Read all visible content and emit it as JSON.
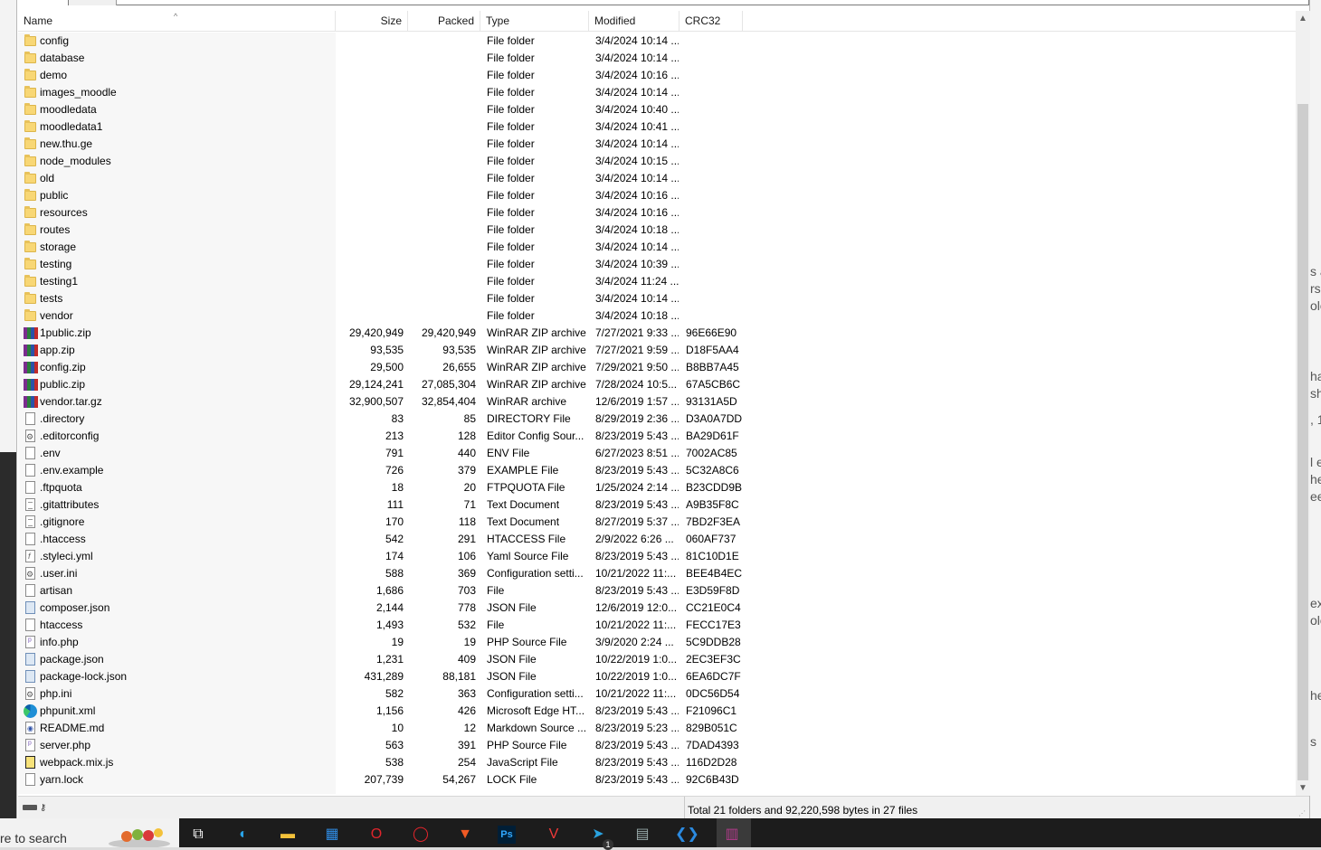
{
  "columns": {
    "name": "Name",
    "size": "Size",
    "packed": "Packed",
    "type": "Type",
    "modified": "Modified",
    "crc": "CRC32"
  },
  "rows": [
    {
      "icon": "folder-icon",
      "name": "config",
      "size": "",
      "packed": "",
      "type": "File folder",
      "modified": "3/4/2024 10:14 ...",
      "crc": ""
    },
    {
      "icon": "folder-icon",
      "name": "database",
      "size": "",
      "packed": "",
      "type": "File folder",
      "modified": "3/4/2024 10:14 ...",
      "crc": ""
    },
    {
      "icon": "folder-icon",
      "name": "demo",
      "size": "",
      "packed": "",
      "type": "File folder",
      "modified": "3/4/2024 10:16 ...",
      "crc": ""
    },
    {
      "icon": "folder-icon",
      "name": "images_moodle",
      "size": "",
      "packed": "",
      "type": "File folder",
      "modified": "3/4/2024 10:14 ...",
      "crc": ""
    },
    {
      "icon": "folder-icon",
      "name": "moodledata",
      "size": "",
      "packed": "",
      "type": "File folder",
      "modified": "3/4/2024 10:40 ...",
      "crc": ""
    },
    {
      "icon": "folder-icon",
      "name": "moodledata1",
      "size": "",
      "packed": "",
      "type": "File folder",
      "modified": "3/4/2024 10:41 ...",
      "crc": ""
    },
    {
      "icon": "folder-icon",
      "name": "new.thu.ge",
      "size": "",
      "packed": "",
      "type": "File folder",
      "modified": "3/4/2024 10:14 ...",
      "crc": ""
    },
    {
      "icon": "folder-icon",
      "name": "node_modules",
      "size": "",
      "packed": "",
      "type": "File folder",
      "modified": "3/4/2024 10:15 ...",
      "crc": ""
    },
    {
      "icon": "folder-icon",
      "name": "old",
      "size": "",
      "packed": "",
      "type": "File folder",
      "modified": "3/4/2024 10:14 ...",
      "crc": ""
    },
    {
      "icon": "folder-icon",
      "name": "public",
      "size": "",
      "packed": "",
      "type": "File folder",
      "modified": "3/4/2024 10:16 ...",
      "crc": ""
    },
    {
      "icon": "folder-icon",
      "name": "resources",
      "size": "",
      "packed": "",
      "type": "File folder",
      "modified": "3/4/2024 10:16 ...",
      "crc": ""
    },
    {
      "icon": "folder-icon",
      "name": "routes",
      "size": "",
      "packed": "",
      "type": "File folder",
      "modified": "3/4/2024 10:18 ...",
      "crc": ""
    },
    {
      "icon": "folder-icon",
      "name": "storage",
      "size": "",
      "packed": "",
      "type": "File folder",
      "modified": "3/4/2024 10:14 ...",
      "crc": ""
    },
    {
      "icon": "folder-icon",
      "name": "testing",
      "size": "",
      "packed": "",
      "type": "File folder",
      "modified": "3/4/2024 10:39 ...",
      "crc": ""
    },
    {
      "icon": "folder-icon",
      "name": "testing1",
      "size": "",
      "packed": "",
      "type": "File folder",
      "modified": "3/4/2024 11:24 ...",
      "crc": ""
    },
    {
      "icon": "folder-icon",
      "name": "tests",
      "size": "",
      "packed": "",
      "type": "File folder",
      "modified": "3/4/2024 10:14 ...",
      "crc": ""
    },
    {
      "icon": "folder-icon",
      "name": "vendor",
      "size": "",
      "packed": "",
      "type": "File folder",
      "modified": "3/4/2024 10:18 ...",
      "crc": ""
    },
    {
      "icon": "winrar-icon",
      "name": "1public.zip",
      "size": "29,420,949",
      "packed": "29,420,949",
      "type": "WinRAR ZIP archive",
      "modified": "7/27/2021 9:33 ...",
      "crc": "96E66E90"
    },
    {
      "icon": "winrar-icon",
      "name": "app.zip",
      "size": "93,535",
      "packed": "93,535",
      "type": "WinRAR ZIP archive",
      "modified": "7/27/2021 9:59 ...",
      "crc": "D18F5AA4"
    },
    {
      "icon": "winrar-icon",
      "name": "config.zip",
      "size": "29,500",
      "packed": "26,655",
      "type": "WinRAR ZIP archive",
      "modified": "7/29/2021 9:50 ...",
      "crc": "B8BB7A45"
    },
    {
      "icon": "winrar-icon",
      "name": "public.zip",
      "size": "29,124,241",
      "packed": "27,085,304",
      "type": "WinRAR ZIP archive",
      "modified": "7/28/2024 10:5...",
      "crc": "67A5CB6C"
    },
    {
      "icon": "winrar-icon",
      "name": "vendor.tar.gz",
      "size": "32,900,507",
      "packed": "32,854,404",
      "type": "WinRAR archive",
      "modified": "12/6/2019 1:57 ...",
      "crc": "93131A5D"
    },
    {
      "icon": "file-icon",
      "name": ".directory",
      "size": "83",
      "packed": "85",
      "type": "DIRECTORY File",
      "modified": "8/29/2019 2:36 ...",
      "crc": "D3A0A7DD"
    },
    {
      "icon": "config-file-icon",
      "name": ".editorconfig",
      "size": "213",
      "packed": "128",
      "type": "Editor Config Sour...",
      "modified": "8/23/2019 5:43 ...",
      "crc": "BA29D61F"
    },
    {
      "icon": "file-icon",
      "name": ".env",
      "size": "791",
      "packed": "440",
      "type": "ENV File",
      "modified": "6/27/2023 8:51 ...",
      "crc": "7002AC85"
    },
    {
      "icon": "file-icon",
      "name": ".env.example",
      "size": "726",
      "packed": "379",
      "type": "EXAMPLE File",
      "modified": "8/23/2019 5:43 ...",
      "crc": "5C32A8C6"
    },
    {
      "icon": "file-icon",
      "name": ".ftpquota",
      "size": "18",
      "packed": "20",
      "type": "FTPQUOTA File",
      "modified": "1/25/2024 2:14 ...",
      "crc": "B23CDD9B"
    },
    {
      "icon": "text-file-icon",
      "name": ".gitattributes",
      "size": "111",
      "packed": "71",
      "type": "Text Document",
      "modified": "8/23/2019 5:43 ...",
      "crc": "A9B35F8C"
    },
    {
      "icon": "text-file-icon",
      "name": ".gitignore",
      "size": "170",
      "packed": "118",
      "type": "Text Document",
      "modified": "8/27/2019 5:37 ...",
      "crc": "7BD2F3EA"
    },
    {
      "icon": "file-icon",
      "name": ".htaccess",
      "size": "542",
      "packed": "291",
      "type": "HTACCESS File",
      "modified": "2/9/2022 6:26 ...",
      "crc": "060AF737"
    },
    {
      "icon": "yaml-file-icon",
      "name": ".styleci.yml",
      "size": "174",
      "packed": "106",
      "type": "Yaml Source File",
      "modified": "8/23/2019 5:43 ...",
      "crc": "81C10D1E"
    },
    {
      "icon": "config-file-icon",
      "name": ".user.ini",
      "size": "588",
      "packed": "369",
      "type": "Configuration setti...",
      "modified": "10/21/2022 11:...",
      "crc": "BEE4B4EC"
    },
    {
      "icon": "file-icon",
      "name": "artisan",
      "size": "1,686",
      "packed": "703",
      "type": "File",
      "modified": "8/23/2019 5:43 ...",
      "crc": "E3D59F8D"
    },
    {
      "icon": "json-file-icon",
      "name": "composer.json",
      "size": "2,144",
      "packed": "778",
      "type": "JSON File",
      "modified": "12/6/2019 12:0...",
      "crc": "CC21E0C4"
    },
    {
      "icon": "file-icon",
      "name": "htaccess",
      "size": "1,493",
      "packed": "532",
      "type": "File",
      "modified": "10/21/2022 11:...",
      "crc": "FECC17E3"
    },
    {
      "icon": "php-file-icon",
      "name": "info.php",
      "size": "19",
      "packed": "19",
      "type": "PHP Source File",
      "modified": "3/9/2020 2:24 ...",
      "crc": "5C9DDB28"
    },
    {
      "icon": "json-file-icon",
      "name": "package.json",
      "size": "1,231",
      "packed": "409",
      "type": "JSON File",
      "modified": "10/22/2019 1:0...",
      "crc": "2EC3EF3C"
    },
    {
      "icon": "json-file-icon",
      "name": "package-lock.json",
      "size": "431,289",
      "packed": "88,181",
      "type": "JSON File",
      "modified": "10/22/2019 1:0...",
      "crc": "6EA6DC7F"
    },
    {
      "icon": "config-file-icon",
      "name": "php.ini",
      "size": "582",
      "packed": "363",
      "type": "Configuration setti...",
      "modified": "10/21/2022 11:...",
      "crc": "0DC56D54"
    },
    {
      "icon": "edge-icon",
      "name": "phpunit.xml",
      "size": "1,156",
      "packed": "426",
      "type": "Microsoft Edge HT...",
      "modified": "8/23/2019 5:43 ...",
      "crc": "F21096C1"
    },
    {
      "icon": "markdown-file-icon",
      "name": "README.md",
      "size": "10",
      "packed": "12",
      "type": "Markdown Source ...",
      "modified": "8/23/2019 5:23 ...",
      "crc": "829B051C"
    },
    {
      "icon": "php-file-icon",
      "name": "server.php",
      "size": "563",
      "packed": "391",
      "type": "PHP Source File",
      "modified": "8/23/2019 5:43 ...",
      "crc": "7DAD4393"
    },
    {
      "icon": "js-file-icon",
      "name": "webpack.mix.js",
      "size": "538",
      "packed": "254",
      "type": "JavaScript File",
      "modified": "8/23/2019 5:43 ...",
      "crc": "116D2D28"
    },
    {
      "icon": "file-icon",
      "name": "yarn.lock",
      "size": "207,739",
      "packed": "54,267",
      "type": "LOCK File",
      "modified": "8/23/2019 5:43 ...",
      "crc": "92C6B43D"
    }
  ],
  "status": {
    "summary": "Total 21 folders and 92,220,598 bytes in 27 files"
  },
  "taskbar": {
    "search_placeholder": "re to search",
    "apps": [
      "task-view-icon",
      "edge-icon",
      "file-explorer-icon",
      "store-icon",
      "opera-icon",
      "opera-gx-icon",
      "brave-icon",
      "photoshop-icon",
      "vivaldi-icon",
      "telegram-icon",
      "calculator-icon",
      "vscode-icon",
      "winrar-icon"
    ],
    "telegram_badge": "1"
  },
  "background": {
    "fragments": [
      "s a",
      "rs,",
      "olo",
      "ha",
      "sh",
      ", 1:",
      "l e",
      "he",
      "ee",
      "ex",
      "olo",
      "he",
      "s"
    ]
  },
  "colors": {
    "folder": "#f8d775",
    "scroll_thumb": "#cdcdcd",
    "taskbar": "#1c1c1c"
  }
}
